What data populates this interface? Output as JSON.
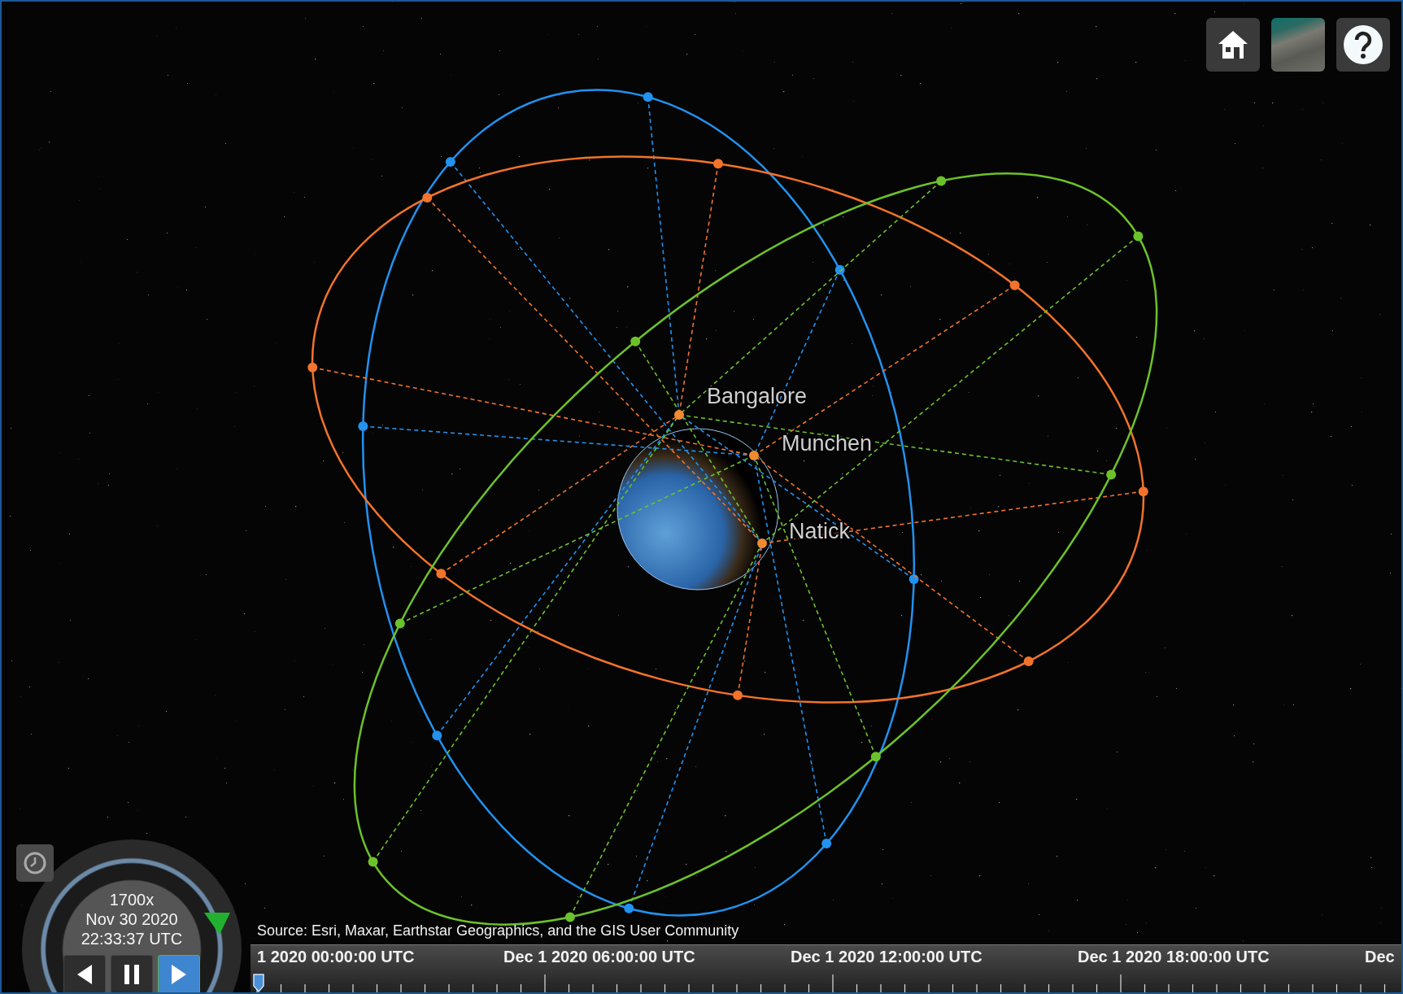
{
  "toolbar": {
    "buttons": [
      {
        "kind": "home"
      },
      {
        "kind": "imagery"
      },
      {
        "kind": "help"
      }
    ]
  },
  "orbits": [
    {
      "color": "#2192f0"
    },
    {
      "color": "#f3732a"
    },
    {
      "color": "#6cc22a"
    }
  ],
  "ground_stations": [
    {
      "name": "Bangalore"
    },
    {
      "name": "Munchen"
    },
    {
      "name": "Natick"
    }
  ],
  "attribution": "Source: Esri, Maxar, Earthstar Geographics, and the GIS User Community",
  "animation": {
    "speed": "1700x",
    "date": "Nov 30 2020",
    "time": "22:33:37 UTC",
    "buttons": [
      {
        "kind": "reverse",
        "selected": false
      },
      {
        "kind": "pause",
        "selected": false
      },
      {
        "kind": "play",
        "selected": true
      }
    ]
  },
  "timeline": {
    "labels": [
      "1 2020 00:00:00 UTC",
      "Dec 1 2020 06:00:00 UTC",
      "Dec 1 2020 12:00:00 UTC",
      "Dec 1 2020 18:00:00 UTC",
      "Dec"
    ]
  }
}
